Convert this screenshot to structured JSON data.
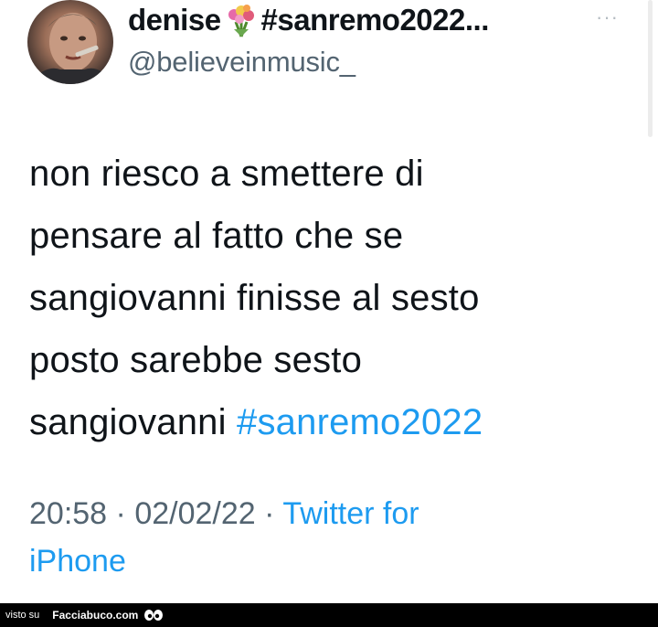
{
  "tweet": {
    "display_name_part1": "denise",
    "display_name_part2": "#sanremo2022...",
    "flower_icon": "bouquet-emoji",
    "handle": "@believeinmusic_",
    "more_label": "···",
    "text_lines": [
      "non riesco a smettere di",
      "pensare al fatto che se",
      "sangiovanni finisse al sesto",
      "posto sarebbe sesto"
    ],
    "text_last_line": "sangiovanni",
    "hashtag": "#sanremo2022",
    "time": "20:58",
    "date": "02/02/22",
    "separator": "·",
    "source": "Twitter for",
    "source_line2": "iPhone",
    "colors": {
      "link": "#1d9bf0",
      "secondary": "#536471",
      "text": "#0f1419"
    }
  },
  "footer": {
    "visto_label": "visto su",
    "site_label": "Facciabuco.com",
    "icon": "eyes-icon"
  }
}
